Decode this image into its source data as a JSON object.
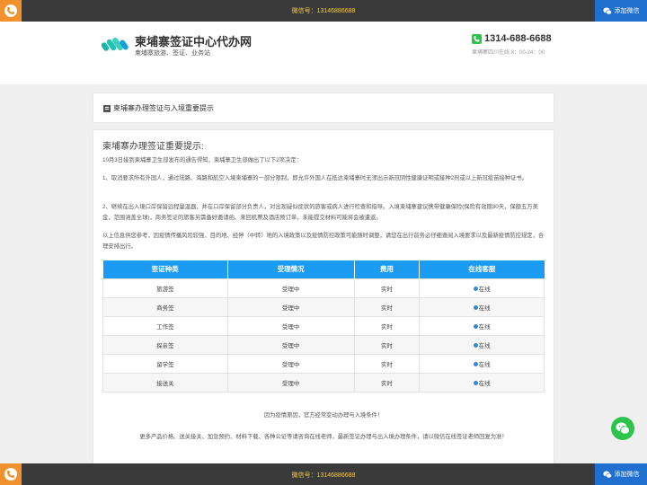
{
  "topbar": {
    "wechat_line": "微信号：13146886688",
    "add_wechat": "添加微信"
  },
  "header": {
    "site_title": "柬埔寨签证中心代办网",
    "site_subtitle": "柬埔寨旅游、签证、业务站",
    "hotline": "1314-688-6688",
    "hotline_note": "柬埔寨四川在线 8：00-24：00"
  },
  "notice_card": {
    "title": "柬埔寨办理签证与入境重要提示"
  },
  "content": {
    "heading": "柬埔寨办理签证重要提示:",
    "paragraphs": [
      "10月3日接到柬埔寨卫生部发布的通告得知，柬埔寨卫生部做出了以下2项决定：",
      "1、取消要求所有外国人，通过陆路、海路和航空入境柬埔寨的一部分限制，即允许外国人在抵达柬埔寨时无须出示新冠阴性健康证明或接种2剂或以上新冠疫苗接种证书。",
      "2、继续在出入境口岸保留远程量温器，并在口岸保留部分负责人，对出现疑似症状的旅客或病人进行检查和指导。入境柬埔寨建议携带健康保险(保险有效期30天，保额五万美金，范围涵盖全球)，商务签证的旅客另需备好邀请函、来回机票及酒店预订单，未能提交材料可能将会被遣返。",
      "以上信息供您参考，因疫情传播风险较强，目的地、经停（中转）地的入境政策以及疫情防控政策可能随时调整，请您在出行前务必仔细查阅入境要求以及最新疫情防控规定，合理安排出行。"
    ],
    "table": {
      "headers": [
        "签证种类",
        "受理情况",
        "费用",
        "在线客服"
      ],
      "rows": [
        [
          "旅游签",
          "受理中",
          "实时",
          "在线"
        ],
        [
          "商务签",
          "受理中",
          "实时",
          "在线"
        ],
        [
          "工作签",
          "受理中",
          "实时",
          "在线"
        ],
        [
          "探亲签",
          "受理中",
          "实时",
          "在线"
        ],
        [
          "留学签",
          "受理中",
          "实时",
          "在线"
        ],
        [
          "接送关",
          "受理中",
          "实时",
          "在线"
        ]
      ]
    },
    "note1": "因为疫情原因，官方经常变动办理与入境条件！",
    "note2": "更多产品价格、送关接关、加急预约、材料下载、各种公证等请咨询在线老师，最新签证办理与出入境办理条件，请以微信在线签证老师回复为准！"
  },
  "colors": {
    "table_header": "#1b9cf2",
    "wechat_green": "#2ec44b",
    "phone_orange": "#f0912e",
    "add_button_blue": "#1e6fd0",
    "bar_text_yellow": "#f2c94c"
  },
  "icons": {
    "phone": "phone-icon",
    "wechat": "wechat-icon",
    "logo": "logo-mark-icon",
    "online": "online-icon",
    "doc": "doc-icon"
  }
}
